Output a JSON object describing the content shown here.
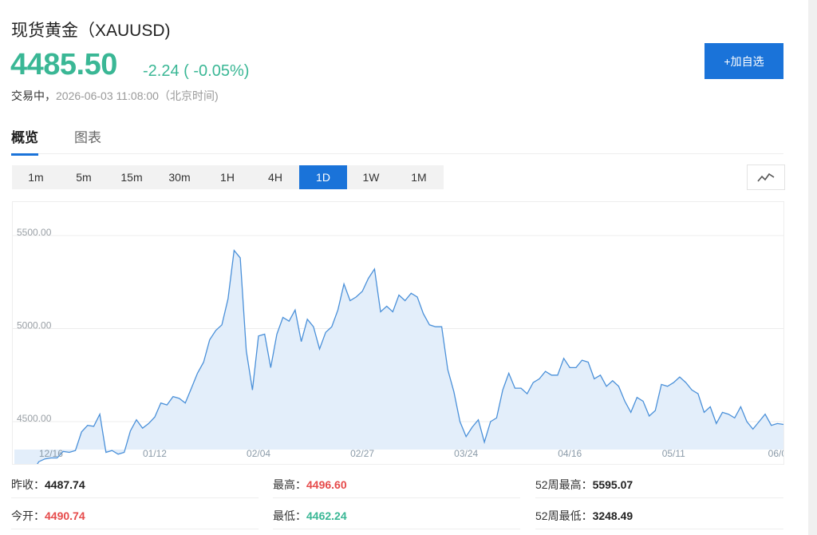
{
  "header": {
    "title": "现货黄金（XAUUSD)",
    "price": "4485.50",
    "change": "-2.24 ( -0.05%)",
    "status": "交易中，",
    "timestamp": "2026-06-03 11:08:00（北京时间)",
    "add_button": "+加自选"
  },
  "tabs": [
    {
      "label": "概览",
      "active": true
    },
    {
      "label": "图表",
      "active": false
    }
  ],
  "periods": [
    {
      "label": "1m",
      "active": false
    },
    {
      "label": "5m",
      "active": false
    },
    {
      "label": "15m",
      "active": false
    },
    {
      "label": "30m",
      "active": false
    },
    {
      "label": "1H",
      "active": false
    },
    {
      "label": "4H",
      "active": false
    },
    {
      "label": "1D",
      "active": true
    },
    {
      "label": "1W",
      "active": false
    },
    {
      "label": "1M",
      "active": false
    }
  ],
  "chart_type_icon": "line-chart-icon",
  "colors": {
    "up": "#e64b4b",
    "down": "#3ab795",
    "accent": "#1a73d9",
    "line": "#4a90d9",
    "fill": "#e3eefa"
  },
  "stats": [
    [
      {
        "label": "昨收：",
        "value": "4487.74",
        "tone": "neutral"
      },
      {
        "label": "最高：",
        "value": "4496.60",
        "tone": "up"
      },
      {
        "label": "52周最高：",
        "value": "5595.07",
        "tone": "neutral"
      }
    ],
    [
      {
        "label": "今开：",
        "value": "4490.74",
        "tone": "up"
      },
      {
        "label": "最低：",
        "value": "4462.24",
        "tone": "down"
      },
      {
        "label": "52周最低：",
        "value": "3248.49",
        "tone": "neutral"
      }
    ]
  ],
  "chart_data": {
    "type": "area",
    "ylim": [
      4350,
      5680
    ],
    "y_ticks": [
      {
        "value": 4500,
        "label": "4500.00"
      },
      {
        "value": 5000,
        "label": "5000.00"
      },
      {
        "value": 5500,
        "label": "5500.00"
      }
    ],
    "x_ticks": [
      {
        "index": 6,
        "label": "12/16"
      },
      {
        "index": 23,
        "label": "01/12"
      },
      {
        "index": 40,
        "label": "02/04"
      },
      {
        "index": 57,
        "label": "02/27"
      },
      {
        "index": 74,
        "label": "03/24"
      },
      {
        "index": 91,
        "label": "04/16"
      },
      {
        "index": 108,
        "label": "05/11"
      },
      {
        "index": 125,
        "label": "06/0"
      }
    ],
    "series": [
      {
        "values": [
          4200,
          4195,
          4215,
          4230,
          4285,
          4300,
          4305,
          4305,
          4340,
          4335,
          4345,
          4445,
          4480,
          4475,
          4540,
          4335,
          4345,
          4325,
          4335,
          4450,
          4510,
          4465,
          4490,
          4525,
          4600,
          4590,
          4635,
          4625,
          4600,
          4680,
          4760,
          4820,
          4940,
          4990,
          5020,
          5160,
          5420,
          5380,
          4880,
          4670,
          4960,
          4970,
          4790,
          4970,
          5060,
          5040,
          5100,
          4930,
          5050,
          5010,
          4890,
          4980,
          5010,
          5100,
          5240,
          5150,
          5170,
          5200,
          5270,
          5320,
          5090,
          5120,
          5090,
          5180,
          5150,
          5190,
          5170,
          5080,
          5020,
          5010,
          5010,
          4780,
          4660,
          4500,
          4420,
          4470,
          4510,
          4390,
          4500,
          4520,
          4670,
          4760,
          4680,
          4680,
          4650,
          4710,
          4730,
          4770,
          4750,
          4750,
          4840,
          4790,
          4790,
          4830,
          4820,
          4730,
          4750,
          4690,
          4720,
          4690,
          4610,
          4550,
          4630,
          4610,
          4530,
          4560,
          4700,
          4690,
          4710,
          4740,
          4710,
          4670,
          4650,
          4550,
          4580,
          4490,
          4550,
          4540,
          4520,
          4580,
          4500,
          4460,
          4500,
          4540,
          4480,
          4490,
          4485
        ]
      }
    ]
  }
}
